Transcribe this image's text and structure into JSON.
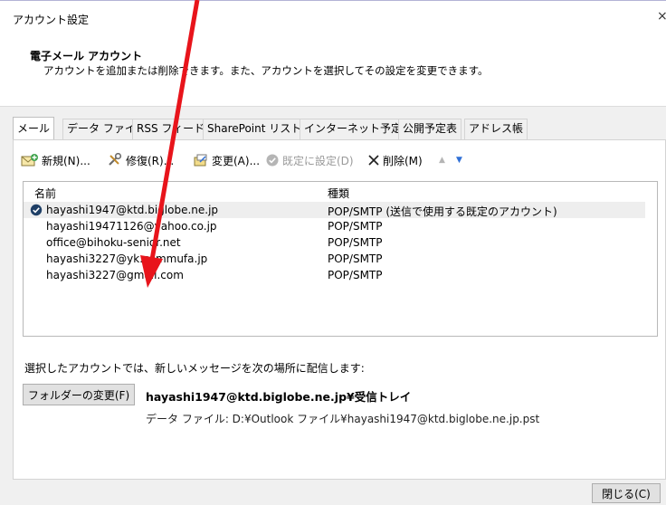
{
  "window": {
    "title": "アカウント設定",
    "close_glyph": "×"
  },
  "header": {
    "section_title": "電子メール アカウント",
    "description": "アカウントを追加または削除できます。また、アカウントを選択してその設定を変更できます。"
  },
  "tabs": [
    {
      "label": "メール",
      "active": true
    },
    {
      "label": "データ ファイル"
    },
    {
      "label": "RSS フィード"
    },
    {
      "label": "SharePoint リスト"
    },
    {
      "label": "インターネット予定表"
    },
    {
      "label": "公開予定表"
    },
    {
      "label": "アドレス帳"
    }
  ],
  "toolbar": {
    "new_label": "新規(N)...",
    "repair_label": "修復(R)...",
    "change_label": "変更(A)...",
    "set_default_label": "既定に設定(D)",
    "remove_label": "削除(M)",
    "move_up_glyph": "▲",
    "move_down_glyph": "▼"
  },
  "accounts": {
    "col_name": "名前",
    "col_type": "種類",
    "rows": [
      {
        "name": "hayashi1947@ktd.biglobe.ne.jp",
        "type": "POP/SMTP (送信で使用する既定のアカウント)",
        "default": true
      },
      {
        "name": "hayashi19471126@yahoo.co.jp",
        "type": "POP/SMTP"
      },
      {
        "name": "office@bihoku-senior.net",
        "type": "POP/SMTP"
      },
      {
        "name": "hayashi3227@yk.commufa.jp",
        "type": "POP/SMTP"
      },
      {
        "name": "hayashi3227@gmail.com",
        "type": "POP/SMTP"
      }
    ]
  },
  "delivery": {
    "label": "選択したアカウントでは、新しいメッセージを次の場所に配信します:",
    "change_folder_button": "フォルダーの変更(F)",
    "target": "hayashi1947@ktd.biglobe.ne.jp¥受信トレイ",
    "data_file": "データ ファイル: D:¥Outlook ファイル¥hayashi1947@ktd.biglobe.ne.jp.pst"
  },
  "footer": {
    "close_button": "閉じる(C)"
  },
  "colors": {
    "annotation_arrow": "#e8141b",
    "default_check": "#1f3f66",
    "arrow_blue": "#2f6fd6",
    "disabled_text": "#9a9a9a"
  }
}
